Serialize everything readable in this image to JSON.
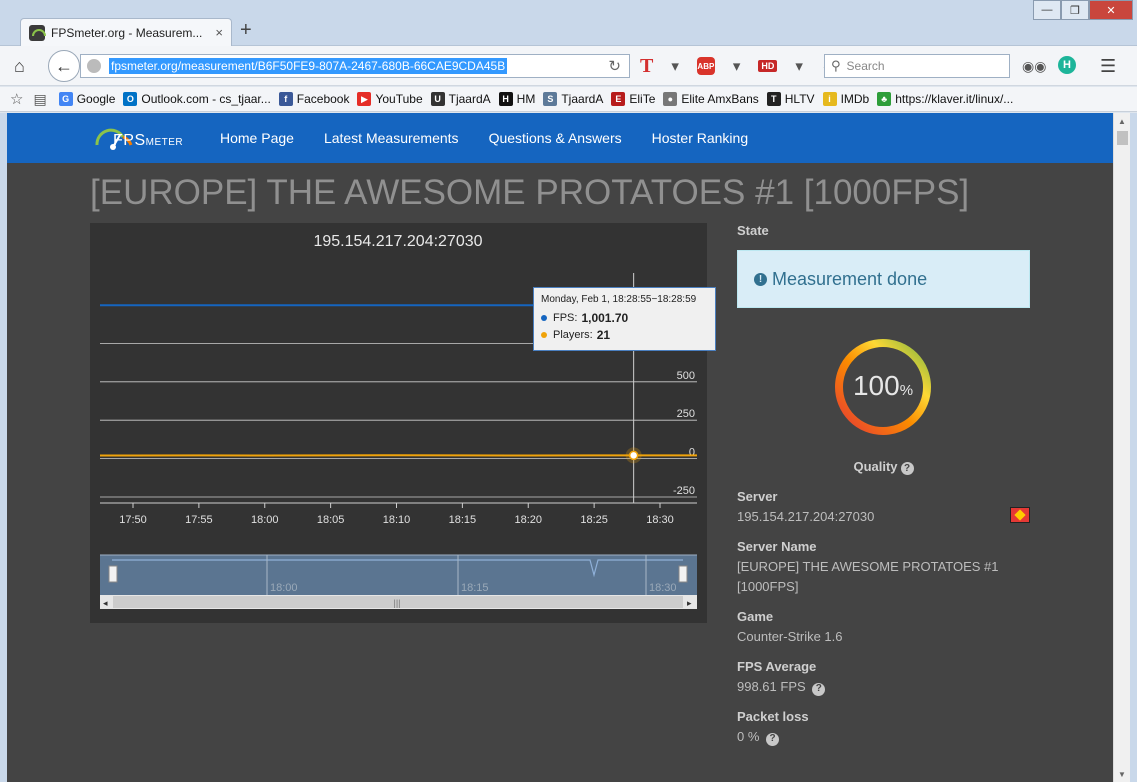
{
  "browser": {
    "tab_title": "FPSmeter.org - Measurem...",
    "tab_close": "×",
    "new_tab": "+",
    "url": "fpsmeter.org/measurement/B6F50FE9-807A-2467-680B-66CAE9CDA45B",
    "search_placeholder": "Search",
    "profile_letter": "H",
    "abp_label": "ABP",
    "hd_label": "HD",
    "bookmarks": [
      {
        "label": "Google",
        "icon": "google-icon",
        "color": "#4285f4",
        "glyph": "G"
      },
      {
        "label": "Outlook.com - cs_tjaar...",
        "icon": "outlook-icon",
        "color": "#0072c6",
        "glyph": "O"
      },
      {
        "label": "Facebook",
        "icon": "facebook-icon",
        "color": "#3b5998",
        "glyph": "f"
      },
      {
        "label": "YouTube",
        "icon": "youtube-icon",
        "color": "#e52d27",
        "glyph": "▶"
      },
      {
        "label": "TjaardA",
        "icon": "tjaarda-icon",
        "color": "#333333",
        "glyph": "U"
      },
      {
        "label": "HM",
        "icon": "hm-icon",
        "color": "#111111",
        "glyph": "H"
      },
      {
        "label": "TjaardA",
        "icon": "steam-icon",
        "color": "#5d7a99",
        "glyph": "S"
      },
      {
        "label": "EliTe",
        "icon": "elite-icon",
        "color": "#b71c1c",
        "glyph": "E"
      },
      {
        "label": "Elite AmxBans",
        "icon": "amxbans-icon",
        "color": "#777777",
        "glyph": "●"
      },
      {
        "label": "HLTV",
        "icon": "hltv-icon",
        "color": "#222222",
        "glyph": "T"
      },
      {
        "label": "IMDb",
        "icon": "imdb-icon",
        "color": "#e6b91e",
        "glyph": "i"
      },
      {
        "label": "https://klaver.it/linux/...",
        "icon": "clover-icon",
        "color": "#2e9e3a",
        "glyph": "♣"
      }
    ]
  },
  "site": {
    "logo_main": "FPS",
    "logo_sub": "METER",
    "nav": [
      "Home Page",
      "Latest Measurements",
      "Questions & Answers",
      "Hoster Ranking"
    ],
    "title": "[EUROPE] THE AWESOME PROTATOES #1 [1000FPS]"
  },
  "chart": {
    "title": "195.154.217.204:27030",
    "tooltip": {
      "date": "Monday, Feb 1, 18:28:55−18:28:59",
      "fps_label": "FPS:",
      "fps_value": "1,001.70",
      "players_label": "Players:",
      "players_value": "21"
    },
    "navigator_labels": [
      "18:00",
      "18:15",
      "18:30"
    ],
    "fps_color": "#1565c0",
    "players_color": "#f0a30a"
  },
  "chart_data": {
    "type": "line",
    "title": "195.154.217.204:27030",
    "x_ticks": [
      "17:50",
      "17:55",
      "18:00",
      "18:05",
      "18:10",
      "18:15",
      "18:20",
      "18:25",
      "18:30"
    ],
    "y_ticks": [
      1000,
      750,
      500,
      250,
      0,
      -250
    ],
    "ylim": [
      -250,
      1000
    ],
    "series": [
      {
        "name": "FPS",
        "color": "#1565c0",
        "x": [
          "17:50",
          "17:55",
          "18:00",
          "18:05",
          "18:10",
          "18:15",
          "18:20",
          "18:25",
          "18:28",
          "18:30"
        ],
        "values": [
          998,
          999,
          998,
          999,
          998,
          999,
          998,
          999,
          1001.7,
          999
        ]
      },
      {
        "name": "Players",
        "color": "#f0a30a",
        "x": [
          "17:50",
          "17:55",
          "18:00",
          "18:05",
          "18:10",
          "18:15",
          "18:20",
          "18:25",
          "18:28",
          "18:30"
        ],
        "values": [
          20,
          21,
          20,
          21,
          22,
          21,
          20,
          21,
          21,
          21
        ]
      }
    ],
    "highlight_x": "18:28"
  },
  "sidebar": {
    "state_label": "State",
    "state_value": "Measurement done",
    "quality_value": "100",
    "quality_unit": "%",
    "quality_percent": 100,
    "quality_label": "Quality",
    "server_label": "Server",
    "server_value": "195.154.217.204:27030",
    "server_name_label": "Server Name",
    "server_name_value": "[EUROPE] THE AWESOME PROTATOES #1 [1000FPS]",
    "game_label": "Game",
    "game_value": "Counter-Strike 1.6",
    "fps_avg_label": "FPS Average",
    "fps_avg_value": "998.61 FPS",
    "packet_loss_label": "Packet loss",
    "packet_loss_value": "0 %"
  }
}
